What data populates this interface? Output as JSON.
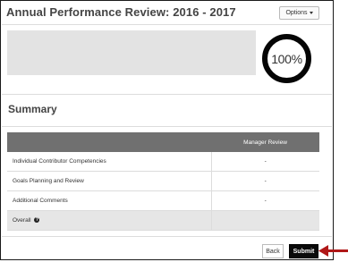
{
  "header": {
    "title": "Annual Performance Review: 2016 - 2017",
    "options_label": "Options",
    "options_icon": "caret-down-icon"
  },
  "progress": {
    "percent_label": "100%",
    "value": 1.0
  },
  "summary": {
    "title": "Summary",
    "columns": [
      "",
      "Manager Review"
    ],
    "rows": [
      {
        "label": "Individual Contributor Competencies",
        "value": "-"
      },
      {
        "label": "Goals Planning and Review",
        "value": "-"
      },
      {
        "label": "Additional Comments",
        "value": "-"
      },
      {
        "label": "Overall",
        "value": ""
      }
    ],
    "overall_help_icon": "help-icon"
  },
  "footer": {
    "back_label": "Back",
    "submit_label": "Submit",
    "arrow_icon": "arrow-left-icon",
    "arrow_color": "#b01818"
  }
}
